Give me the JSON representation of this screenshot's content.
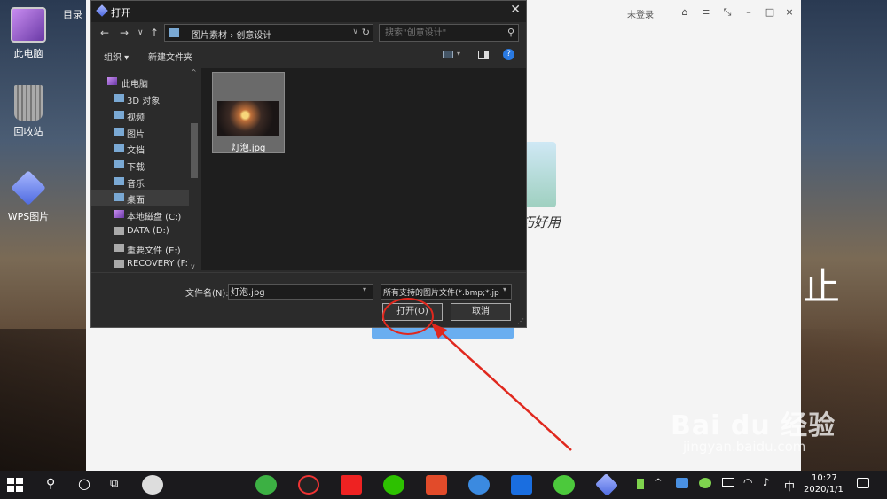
{
  "desktop": {
    "icons": [
      {
        "label": "此电脑"
      },
      {
        "label": "回收站"
      },
      {
        "label": "WPS图片"
      }
    ]
  },
  "app": {
    "menu": "目录",
    "login": "未登录",
    "slogan": "巧好用",
    "controls": [
      "⌂",
      "≡",
      "⤡",
      "–",
      "□",
      "×"
    ]
  },
  "dialog": {
    "title": "打开",
    "close": "✕",
    "nav": {
      "back": "←",
      "forward": "→",
      "recent": "∨",
      "up": "↑"
    },
    "address": {
      "path": "图片素材 › 创意设计",
      "refresh": "↻",
      "dropdown": "∨"
    },
    "search": {
      "placeholder": "搜索\"创意设计\""
    },
    "toolbar": {
      "organize": "组织 ▾",
      "new_folder": "新建文件夹",
      "help": "?"
    },
    "nav_pane": [
      {
        "label": "此电脑"
      },
      {
        "label": "3D 对象"
      },
      {
        "label": "视频"
      },
      {
        "label": "图片"
      },
      {
        "label": "文档"
      },
      {
        "label": "下载"
      },
      {
        "label": "音乐"
      },
      {
        "label": "桌面",
        "selected": true
      },
      {
        "label": "本地磁盘 (C:)"
      },
      {
        "label": "DATA (D:)"
      },
      {
        "label": "重要文件 (E:)"
      },
      {
        "label": "RECOVERY (F:)"
      }
    ],
    "files": [
      {
        "name": "灯泡.jpg"
      }
    ],
    "filename_label": "文件名(N):",
    "filename_value": "灯泡.jpg",
    "filetype": "所有支持的图片文件(*.bmp;*.jp",
    "open_button": "打开(O)",
    "cancel_button": "取消"
  },
  "watermark": {
    "main": "Bai du 经验",
    "sub": "jingyan.baidu.com"
  },
  "taskbar": {
    "ime": "中",
    "time": "10:27",
    "date": "2020/1/1"
  },
  "colors": {
    "annotation": "#e0281e",
    "dialog_bg": "#2b2b2b",
    "accent": "#2a7ae2"
  }
}
